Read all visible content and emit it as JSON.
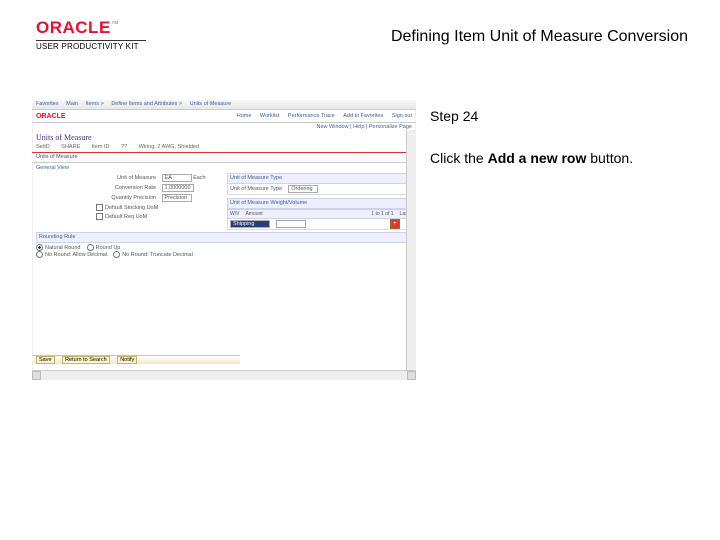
{
  "header": {
    "brand": "ORACLE",
    "tm": "™",
    "product": "USER PRODUCTIVITY KIT",
    "title": "Defining Item Unit of Measure Conversion"
  },
  "instruction": {
    "step": "Step 24",
    "text_before": "Click the ",
    "bold": "Add a new row",
    "text_after": " button."
  },
  "shot": {
    "nav": [
      "Favorites",
      "Main",
      "Items >",
      "Define Items and Attributes >",
      "Units of Measure"
    ],
    "brand": "ORACLE",
    "tabs": [
      "Home",
      "Worklist",
      "Performance Trace",
      "Add to Favorites",
      "Sign out"
    ],
    "userline": "New Window | Help | Personalize Page",
    "h1": "Units of Measure",
    "meta": {
      "setid_l": "SetID",
      "setid_v": "SHARE",
      "itemid_l": "Item ID",
      "itemid_v": "??",
      "desc": "Wiring, 2 AWG, Shielded"
    },
    "tab1": "Units of Measure",
    "sect": "General View",
    "form": {
      "uom_l": "Unit of Measure",
      "uom_v": "EA",
      "uom_hint": "Each",
      "conv_l": "Conversion Rate",
      "conv_v": "1.0000000",
      "qty_l": "Quantity Precision",
      "qty_v": "Precision",
      "cb1": "Default Stocking UoM",
      "cb2": "Default Req UoM"
    },
    "colA": {
      "hdr": "Unit of Measure Type",
      "sub": "Unit of Measure Type",
      "opt": "Ordering"
    },
    "colB": {
      "hdr": "Unit of Measure Weight/Volume",
      "cols": [
        "W/V",
        "Amount",
        "1 to 1 of 1",
        "Last"
      ],
      "row": {
        "sel": "Shipping",
        "amt": "",
        "add": "+"
      }
    },
    "rounding": {
      "hdr": "Rounding Rule",
      "r1": "Natural Round",
      "r2": "Round Up",
      "r3": "No Round: Allow Decimal",
      "r4": "No Round: Truncate Decimal"
    },
    "bottomtabs": {
      "a": "Save",
      "b": "Return to Search",
      "c": "Notify"
    }
  }
}
